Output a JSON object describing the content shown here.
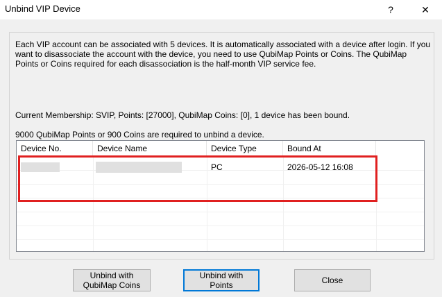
{
  "window": {
    "title": "Unbind VIP Device",
    "help_label": "?",
    "close_label": "✕"
  },
  "description": "Each VIP account can be associated with 5 devices. It is automatically associated with a device after login. If you want to disassociate the account with the device, you need to use QubiMap Points or Coins. The QubiMap Points or Coins required for each disassociation is the half-month VIP service fee.",
  "membership": {
    "line1": "Current Membership: SVIP, Points: [27000], QubiMap Coins: [0], 1 device has been bound.",
    "line2": "9000 QubiMap Points or 900 Coins are required to unbind a device."
  },
  "table": {
    "columns": [
      "Device No.",
      "Device Name",
      "Device Type",
      "Bound At"
    ],
    "rows": [
      {
        "device_type": "PC",
        "bound_at": "2026-05-12 16:08"
      }
    ]
  },
  "buttons": {
    "unbind_coins": "Unbind with\nQubiMap Coins",
    "unbind_points": "Unbind with Points",
    "close": "Close"
  },
  "colors": {
    "highlight": "#e02020",
    "focus": "#0078d7",
    "dialog_bg": "#f0f0f0"
  }
}
